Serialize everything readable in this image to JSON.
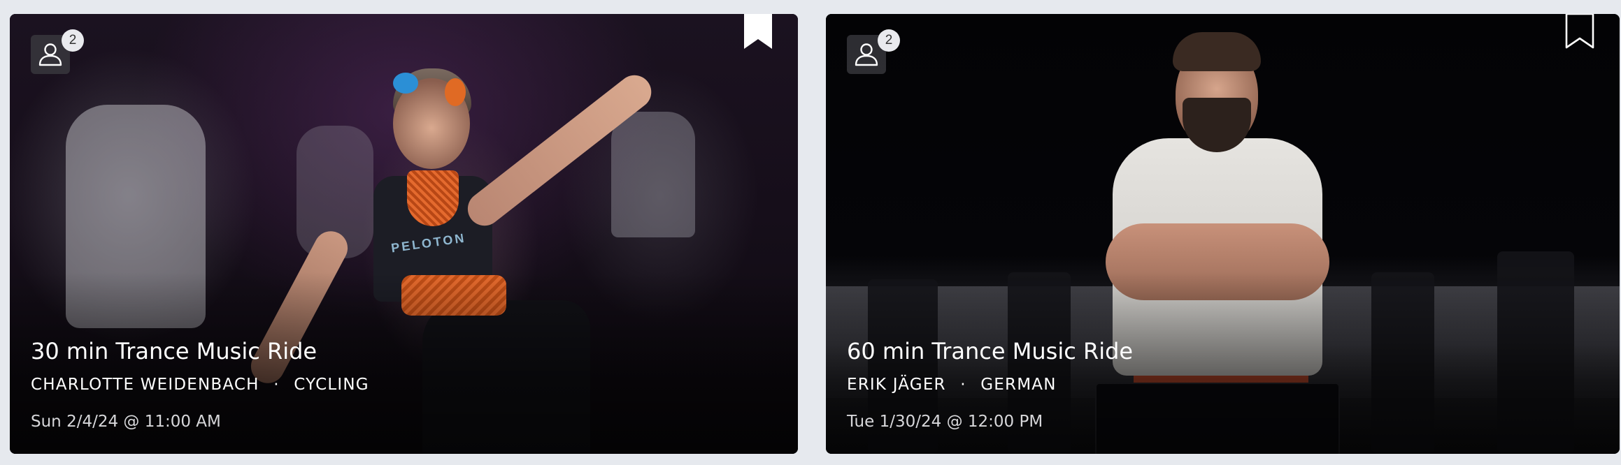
{
  "cards": [
    {
      "title": "30 min Trance Music Ride",
      "instructor": "CHARLOTTE WEIDENBACH",
      "category": "CYCLING",
      "separator": "·",
      "date": "Sun 2/4/24 @ 11:00 AM",
      "participants_badge": "2",
      "shirt_brand": "PELOTON",
      "bookmarked": true,
      "icons": [
        "user-icon",
        "bookmark-icon"
      ]
    },
    {
      "title": "60 min Trance Music Ride",
      "instructor": "ERIK JÄGER",
      "category": "GERMAN",
      "separator": "·",
      "date": "Tue 1/30/24 @ 12:00 PM",
      "participants_badge": "2",
      "bookmarked": false,
      "icons": [
        "user-icon",
        "bookmark-icon"
      ]
    }
  ],
  "colors": {
    "page_background": "#e6e9ee",
    "text": "#ffffff",
    "badge_background": "#e9eaee"
  }
}
